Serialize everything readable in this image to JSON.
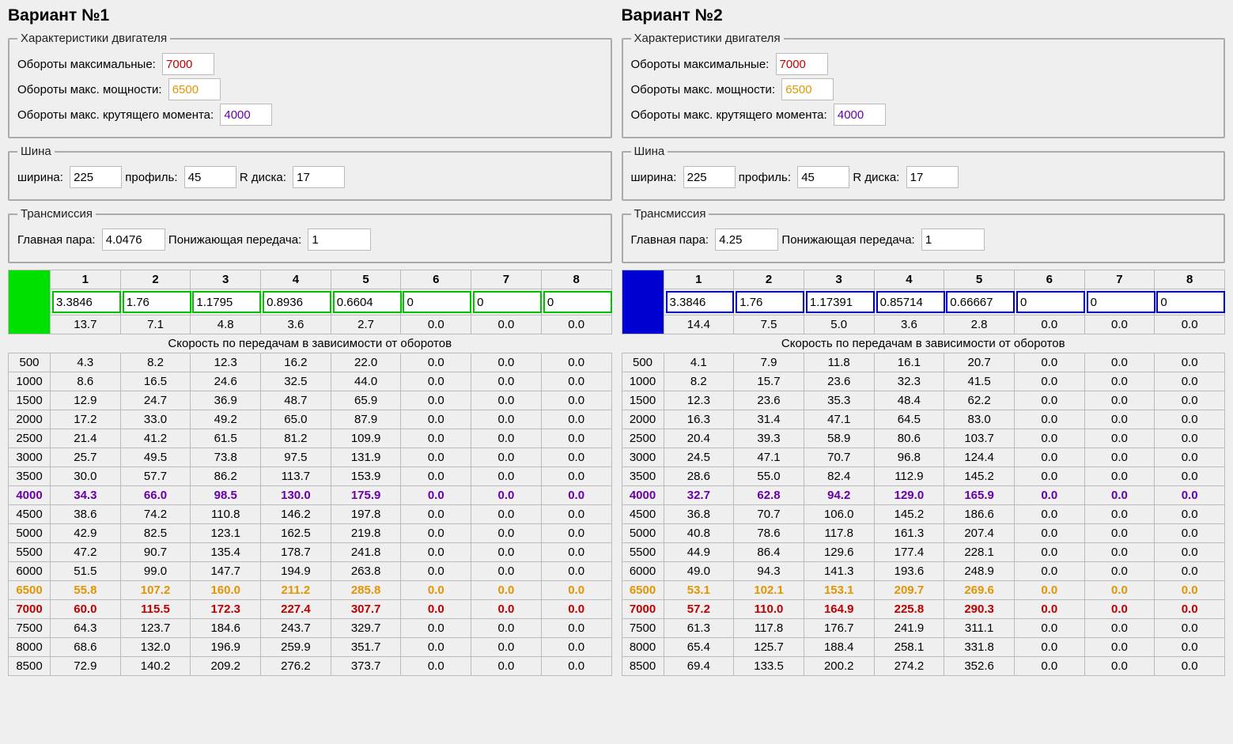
{
  "labels": {
    "variant1": "Вариант №1",
    "variant2": "Вариант №2",
    "engine": "Характеристики двигателя",
    "rpm_max": "Обороты максимальные:",
    "rpm_power": "Обороты макс. мощности:",
    "rpm_torque": "Обороты макс. крутящего момента:",
    "tire": "Шина",
    "width": "ширина:",
    "profile": "профиль:",
    "rim": "R диска:",
    "trans": "Трансмиссия",
    "final_drive": "Главная пара:",
    "reduction": "Понижающая передача:",
    "speed_caption": "Скорость по передачам в зависимости от оборотов"
  },
  "v1": {
    "rpm_max": "7000",
    "rpm_power": "6500",
    "rpm_torque": "4000",
    "tire_w": "225",
    "tire_p": "45",
    "tire_r": "17",
    "final_drive": "4.0476",
    "reduction": "1",
    "gears": [
      "3.3846",
      "1.76",
      "1.1795",
      "0.8936",
      "0.6604",
      "0",
      "0",
      "0"
    ],
    "gear_ratios": [
      "13.7",
      "7.1",
      "4.8",
      "3.6",
      "2.7",
      "0.0",
      "0.0",
      "0.0"
    ],
    "rows": [
      {
        "rpm": "500",
        "v": [
          "4.3",
          "8.2",
          "12.3",
          "16.2",
          "22.0",
          "0.0",
          "0.0",
          "0.0"
        ]
      },
      {
        "rpm": "1000",
        "v": [
          "8.6",
          "16.5",
          "24.6",
          "32.5",
          "44.0",
          "0.0",
          "0.0",
          "0.0"
        ]
      },
      {
        "rpm": "1500",
        "v": [
          "12.9",
          "24.7",
          "36.9",
          "48.7",
          "65.9",
          "0.0",
          "0.0",
          "0.0"
        ]
      },
      {
        "rpm": "2000",
        "v": [
          "17.2",
          "33.0",
          "49.2",
          "65.0",
          "87.9",
          "0.0",
          "0.0",
          "0.0"
        ]
      },
      {
        "rpm": "2500",
        "v": [
          "21.4",
          "41.2",
          "61.5",
          "81.2",
          "109.9",
          "0.0",
          "0.0",
          "0.0"
        ]
      },
      {
        "rpm": "3000",
        "v": [
          "25.7",
          "49.5",
          "73.8",
          "97.5",
          "131.9",
          "0.0",
          "0.0",
          "0.0"
        ]
      },
      {
        "rpm": "3500",
        "v": [
          "30.0",
          "57.7",
          "86.2",
          "113.7",
          "153.9",
          "0.0",
          "0.0",
          "0.0"
        ]
      },
      {
        "rpm": "4000",
        "v": [
          "34.3",
          "66.0",
          "98.5",
          "130.0",
          "175.9",
          "0.0",
          "0.0",
          "0.0"
        ],
        "hl": "pur"
      },
      {
        "rpm": "4500",
        "v": [
          "38.6",
          "74.2",
          "110.8",
          "146.2",
          "197.8",
          "0.0",
          "0.0",
          "0.0"
        ]
      },
      {
        "rpm": "5000",
        "v": [
          "42.9",
          "82.5",
          "123.1",
          "162.5",
          "219.8",
          "0.0",
          "0.0",
          "0.0"
        ]
      },
      {
        "rpm": "5500",
        "v": [
          "47.2",
          "90.7",
          "135.4",
          "178.7",
          "241.8",
          "0.0",
          "0.0",
          "0.0"
        ]
      },
      {
        "rpm": "6000",
        "v": [
          "51.5",
          "99.0",
          "147.7",
          "194.9",
          "263.8",
          "0.0",
          "0.0",
          "0.0"
        ]
      },
      {
        "rpm": "6500",
        "v": [
          "55.8",
          "107.2",
          "160.0",
          "211.2",
          "285.8",
          "0.0",
          "0.0",
          "0.0"
        ],
        "hl": "org"
      },
      {
        "rpm": "7000",
        "v": [
          "60.0",
          "115.5",
          "172.3",
          "227.4",
          "307.7",
          "0.0",
          "0.0",
          "0.0"
        ],
        "hl": "red"
      },
      {
        "rpm": "7500",
        "v": [
          "64.3",
          "123.7",
          "184.6",
          "243.7",
          "329.7",
          "0.0",
          "0.0",
          "0.0"
        ]
      },
      {
        "rpm": "8000",
        "v": [
          "68.6",
          "132.0",
          "196.9",
          "259.9",
          "351.7",
          "0.0",
          "0.0",
          "0.0"
        ]
      },
      {
        "rpm": "8500",
        "v": [
          "72.9",
          "140.2",
          "209.2",
          "276.2",
          "373.7",
          "0.0",
          "0.0",
          "0.0"
        ]
      }
    ]
  },
  "v2": {
    "rpm_max": "7000",
    "rpm_power": "6500",
    "rpm_torque": "4000",
    "tire_w": "225",
    "tire_p": "45",
    "tire_r": "17",
    "final_drive": "4.25",
    "reduction": "1",
    "gears": [
      "3.3846",
      "1.76",
      "1.17391",
      "0.85714",
      "0.66667",
      "0",
      "0",
      "0"
    ],
    "gear_ratios": [
      "14.4",
      "7.5",
      "5.0",
      "3.6",
      "2.8",
      "0.0",
      "0.0",
      "0.0"
    ],
    "rows": [
      {
        "rpm": "500",
        "v": [
          "4.1",
          "7.9",
          "11.8",
          "16.1",
          "20.7",
          "0.0",
          "0.0",
          "0.0"
        ]
      },
      {
        "rpm": "1000",
        "v": [
          "8.2",
          "15.7",
          "23.6",
          "32.3",
          "41.5",
          "0.0",
          "0.0",
          "0.0"
        ]
      },
      {
        "rpm": "1500",
        "v": [
          "12.3",
          "23.6",
          "35.3",
          "48.4",
          "62.2",
          "0.0",
          "0.0",
          "0.0"
        ]
      },
      {
        "rpm": "2000",
        "v": [
          "16.3",
          "31.4",
          "47.1",
          "64.5",
          "83.0",
          "0.0",
          "0.0",
          "0.0"
        ]
      },
      {
        "rpm": "2500",
        "v": [
          "20.4",
          "39.3",
          "58.9",
          "80.6",
          "103.7",
          "0.0",
          "0.0",
          "0.0"
        ]
      },
      {
        "rpm": "3000",
        "v": [
          "24.5",
          "47.1",
          "70.7",
          "96.8",
          "124.4",
          "0.0",
          "0.0",
          "0.0"
        ]
      },
      {
        "rpm": "3500",
        "v": [
          "28.6",
          "55.0",
          "82.4",
          "112.9",
          "145.2",
          "0.0",
          "0.0",
          "0.0"
        ]
      },
      {
        "rpm": "4000",
        "v": [
          "32.7",
          "62.8",
          "94.2",
          "129.0",
          "165.9",
          "0.0",
          "0.0",
          "0.0"
        ],
        "hl": "pur"
      },
      {
        "rpm": "4500",
        "v": [
          "36.8",
          "70.7",
          "106.0",
          "145.2",
          "186.6",
          "0.0",
          "0.0",
          "0.0"
        ]
      },
      {
        "rpm": "5000",
        "v": [
          "40.8",
          "78.6",
          "117.8",
          "161.3",
          "207.4",
          "0.0",
          "0.0",
          "0.0"
        ]
      },
      {
        "rpm": "5500",
        "v": [
          "44.9",
          "86.4",
          "129.6",
          "177.4",
          "228.1",
          "0.0",
          "0.0",
          "0.0"
        ]
      },
      {
        "rpm": "6000",
        "v": [
          "49.0",
          "94.3",
          "141.3",
          "193.6",
          "248.9",
          "0.0",
          "0.0",
          "0.0"
        ]
      },
      {
        "rpm": "6500",
        "v": [
          "53.1",
          "102.1",
          "153.1",
          "209.7",
          "269.6",
          "0.0",
          "0.0",
          "0.0"
        ],
        "hl": "org"
      },
      {
        "rpm": "7000",
        "v": [
          "57.2",
          "110.0",
          "164.9",
          "225.8",
          "290.3",
          "0.0",
          "0.0",
          "0.0"
        ],
        "hl": "red"
      },
      {
        "rpm": "7500",
        "v": [
          "61.3",
          "117.8",
          "176.7",
          "241.9",
          "311.1",
          "0.0",
          "0.0",
          "0.0"
        ]
      },
      {
        "rpm": "8000",
        "v": [
          "65.4",
          "125.7",
          "188.4",
          "258.1",
          "331.8",
          "0.0",
          "0.0",
          "0.0"
        ]
      },
      {
        "rpm": "8500",
        "v": [
          "69.4",
          "133.5",
          "200.2",
          "274.2",
          "352.6",
          "0.0",
          "0.0",
          "0.0"
        ]
      }
    ]
  }
}
